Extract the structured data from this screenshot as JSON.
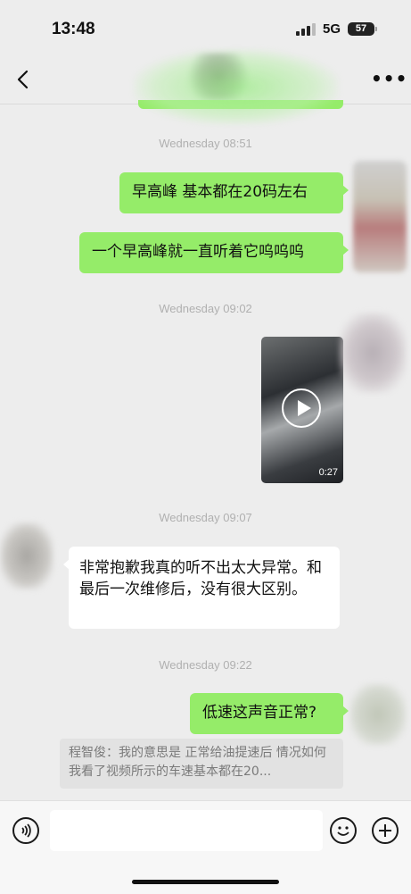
{
  "status": {
    "time": "13:48",
    "network": "5G",
    "battery": "57"
  },
  "header": {
    "back_icon": "chevron-left-icon",
    "more_label": "•••"
  },
  "messages": [
    {
      "type": "timestamp",
      "text": "Wednesday 08:51"
    },
    {
      "type": "out",
      "text": "早高峰 基本都在20码左右"
    },
    {
      "type": "out",
      "text": "一个早高峰就一直听着它呜呜呜"
    },
    {
      "type": "timestamp",
      "text": "Wednesday 09:02"
    },
    {
      "type": "video",
      "duration": "0:27"
    },
    {
      "type": "timestamp",
      "text": "Wednesday 09:07"
    },
    {
      "type": "in",
      "text": "非常抱歉我真的听不出太大异常。和最后一次维修后，没有很大区别。"
    },
    {
      "type": "timestamp",
      "text": "Wednesday 09:22"
    },
    {
      "type": "out",
      "text": "低速这声音正常?"
    }
  ],
  "quote": {
    "text": "程智俊：我的意思是 正常给油提速后 情况如何 我看了视频所示的车速基本都在20..."
  },
  "input": {
    "placeholder": "",
    "voice_icon": "voice-icon",
    "emoji_icon": "emoji-icon",
    "plus_icon": "plus-icon"
  },
  "colors": {
    "outgoing_bubble": "#95ec69",
    "incoming_bubble": "#ffffff",
    "background": "#ededed"
  }
}
